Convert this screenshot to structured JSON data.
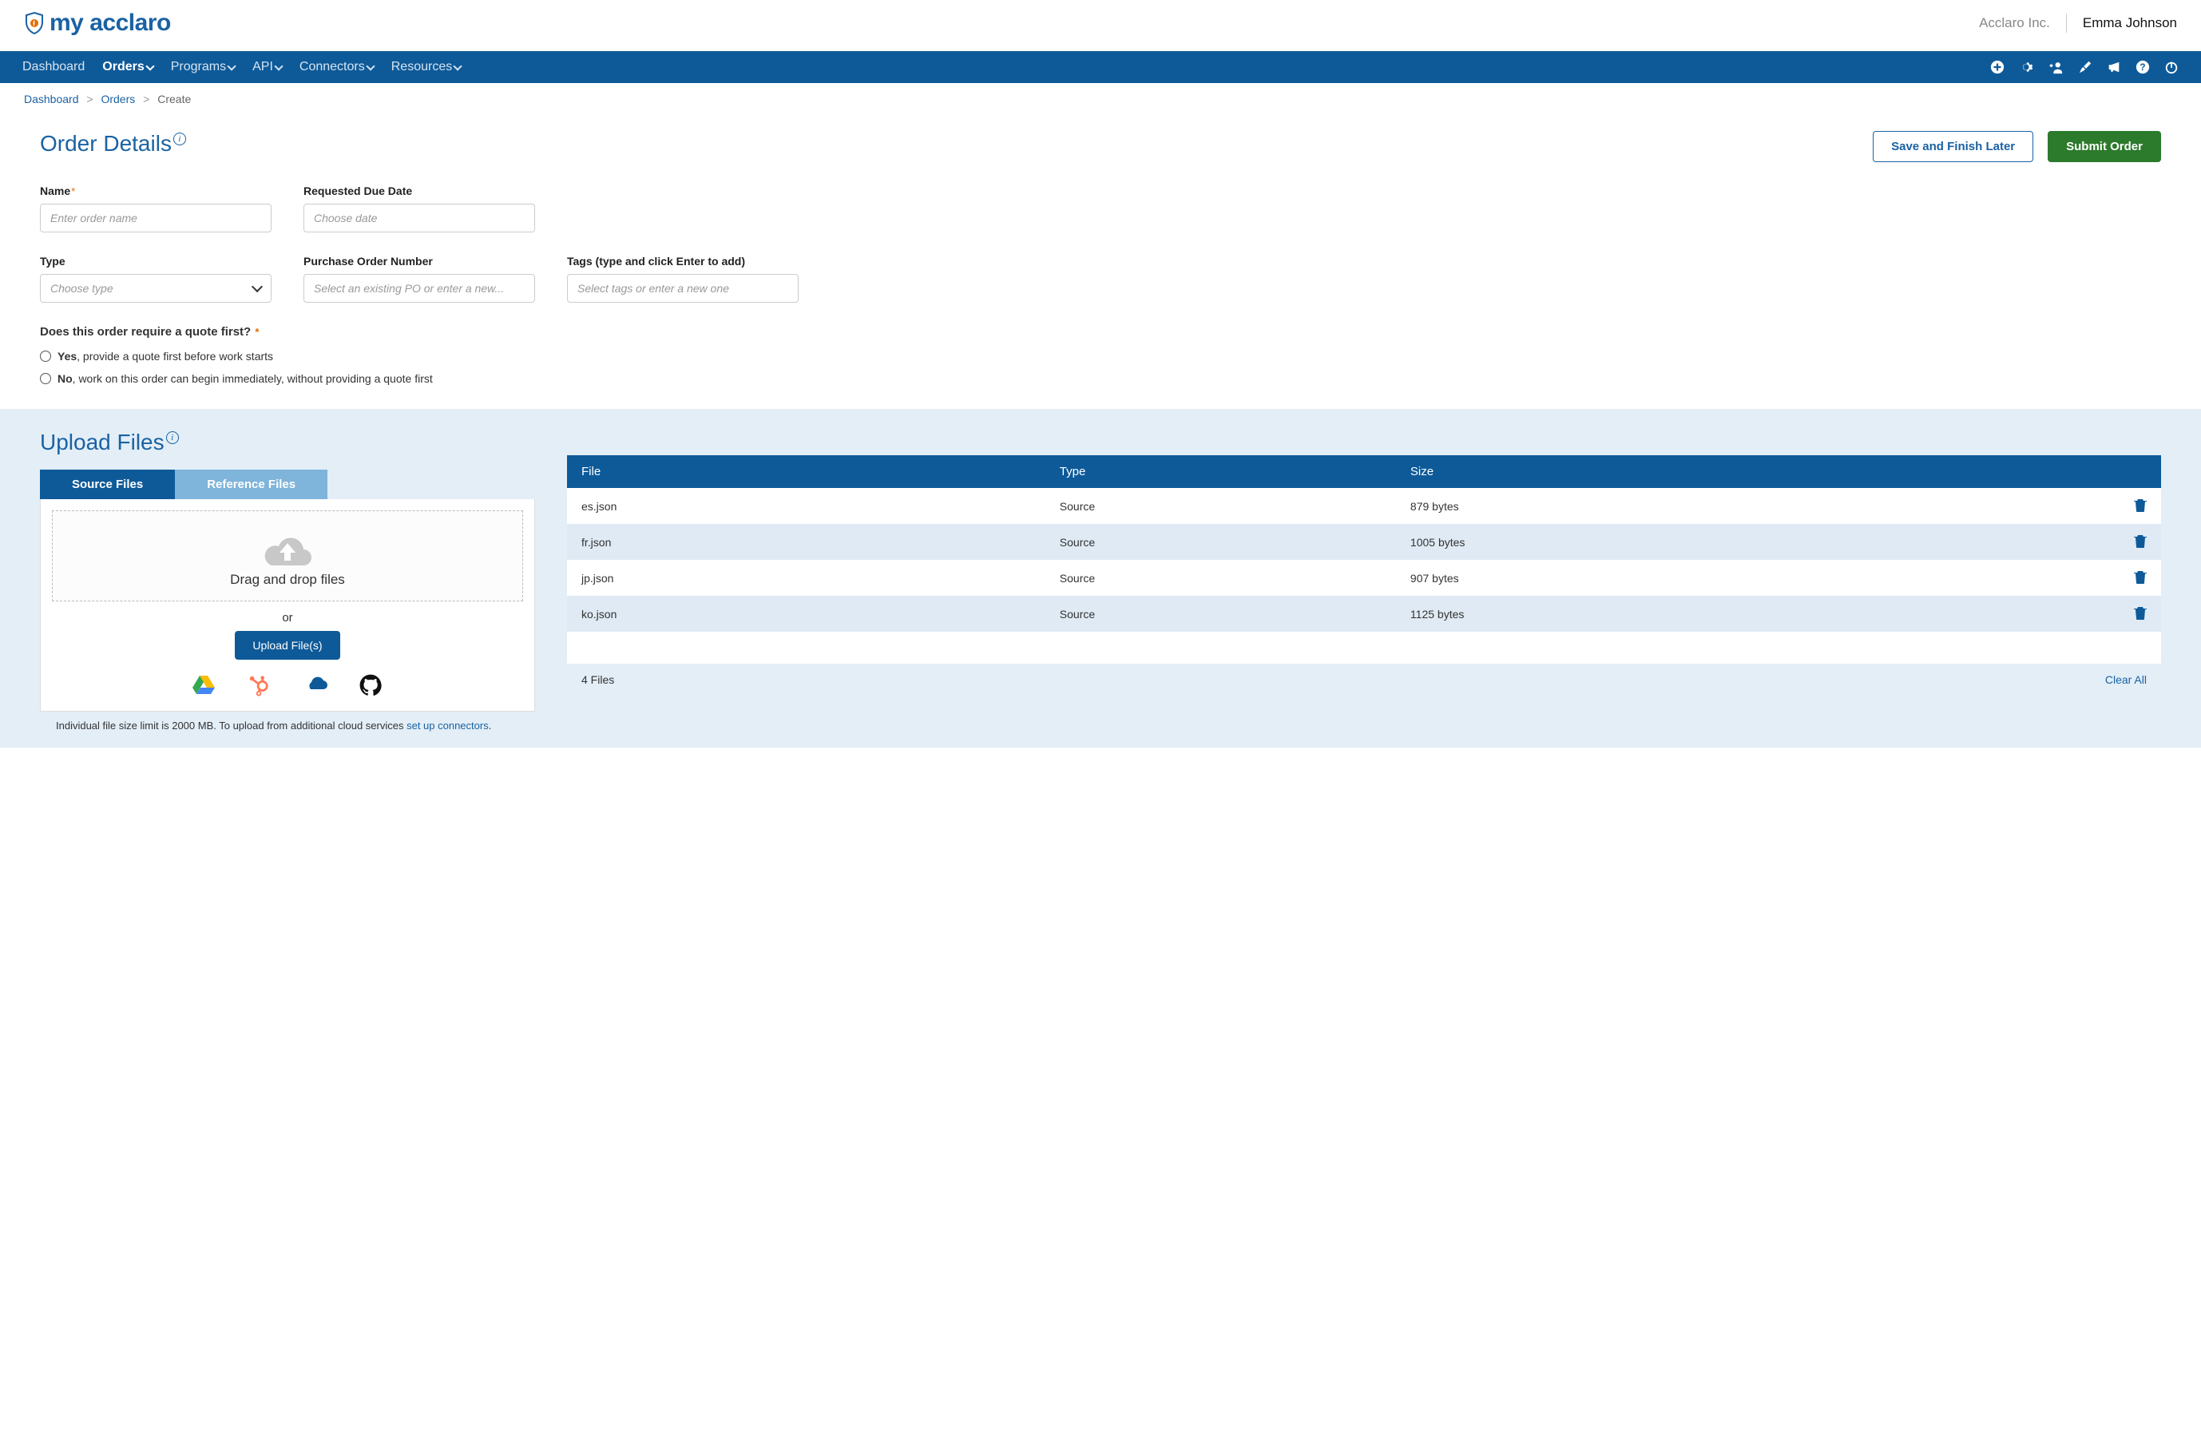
{
  "header": {
    "logo_text": "my acclaro",
    "company": "Acclaro Inc.",
    "user": "Emma Johnson"
  },
  "nav": {
    "items": [
      "Dashboard",
      "Orders",
      "Programs",
      "API",
      "Connectors",
      "Resources"
    ],
    "active": "Orders"
  },
  "breadcrumb": {
    "dashboard": "Dashboard",
    "orders": "Orders",
    "create": "Create"
  },
  "details": {
    "title": "Order Details",
    "save_label": "Save and Finish Later",
    "submit_label": "Submit Order",
    "name_label": "Name",
    "name_placeholder": "Enter order name",
    "due_label": "Requested Due Date",
    "due_placeholder": "Choose date",
    "type_label": "Type",
    "type_placeholder": "Choose type",
    "po_label": "Purchase Order Number",
    "po_placeholder": "Select an existing PO or enter a new...",
    "tags_label": "Tags (type and click Enter to add)",
    "tags_placeholder": "Select tags or enter a new one",
    "quote_question": "Does this order require a quote first?",
    "yes_bold": "Yes",
    "yes_rest": ", provide a quote first before work starts",
    "no_bold": "No",
    "no_rest": ", work on this order can begin immediately, without providing a quote first"
  },
  "upload": {
    "title": "Upload Files",
    "tab_source": "Source Files",
    "tab_reference": "Reference Files",
    "drop_text": "Drag and drop files",
    "or_text": "or",
    "upload_btn": "Upload File(s)",
    "limit_prefix": "Individual file size limit is 2000 MB. To upload from additional cloud services ",
    "limit_link": "set up connectors",
    "table": {
      "col_file": "File",
      "col_type": "Type",
      "col_size": "Size"
    },
    "files": [
      {
        "name": "es.json",
        "type": "Source",
        "size": "879 bytes"
      },
      {
        "name": "fr.json",
        "type": "Source",
        "size": "1005 bytes"
      },
      {
        "name": "jp.json",
        "type": "Source",
        "size": "907 bytes"
      },
      {
        "name": "ko.json",
        "type": "Source",
        "size": "1125 bytes"
      }
    ],
    "file_count": "4 Files",
    "clear_all": "Clear All"
  }
}
